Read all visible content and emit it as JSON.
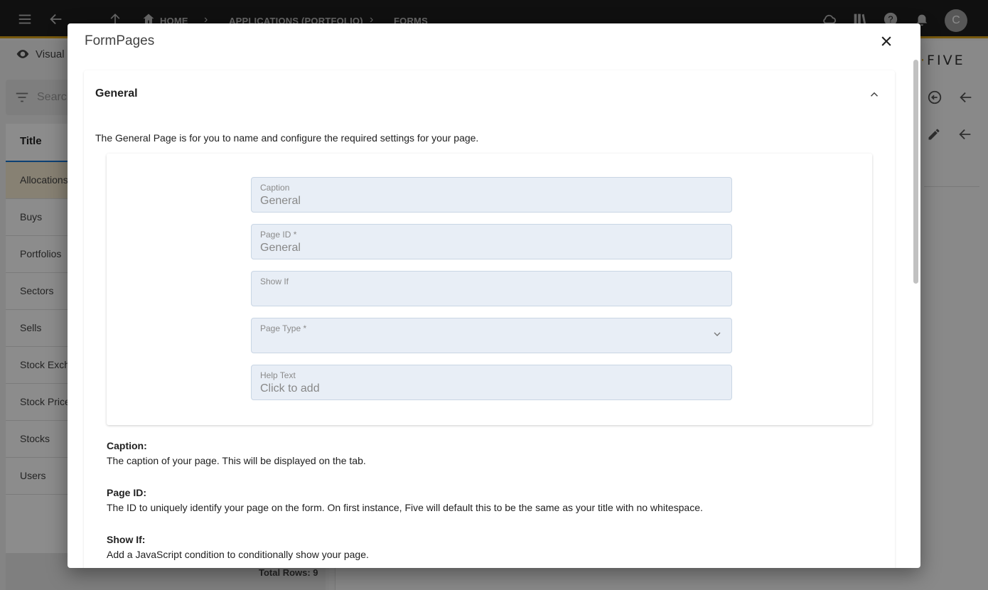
{
  "app": {
    "breadcrumbs": [
      "HOME",
      "APPLICATIONS (PORTFOLIO)",
      "FORMS"
    ],
    "avatar_initial": "C",
    "brand": "FIVE",
    "visual_label": "Visual",
    "search_placeholder": "Search",
    "list_header": "Title",
    "list_items": [
      "Allocations",
      "Buys",
      "Portfolios",
      "Sectors",
      "Sells",
      "Stock Exch",
      "Stock Price",
      "Stocks",
      "Users"
    ],
    "total_rows": "Total Rows: 9"
  },
  "dialog": {
    "title": "FormPages",
    "section_title": "General",
    "intro": "The General Page is for you to name and configure the required settings for your page.",
    "fields": {
      "caption": {
        "label": "Caption",
        "value": "General"
      },
      "page_id": {
        "label": "Page ID *",
        "value": "General"
      },
      "show_if": {
        "label": "Show If",
        "value": ""
      },
      "page_type": {
        "label": "Page Type *",
        "value": ""
      },
      "help_text": {
        "label": "Help Text",
        "value": "Click to add"
      }
    },
    "help": [
      {
        "title": "Caption:",
        "text": "The caption of your page. This will be displayed on the tab."
      },
      {
        "title": "Page ID:",
        "text": "The ID to uniquely identify your page on the form. On first instance, Five will default this to be the same as your title with no whitespace."
      },
      {
        "title": "Show If:",
        "text": "Add a JavaScript condition to conditionally show your page."
      }
    ]
  }
}
